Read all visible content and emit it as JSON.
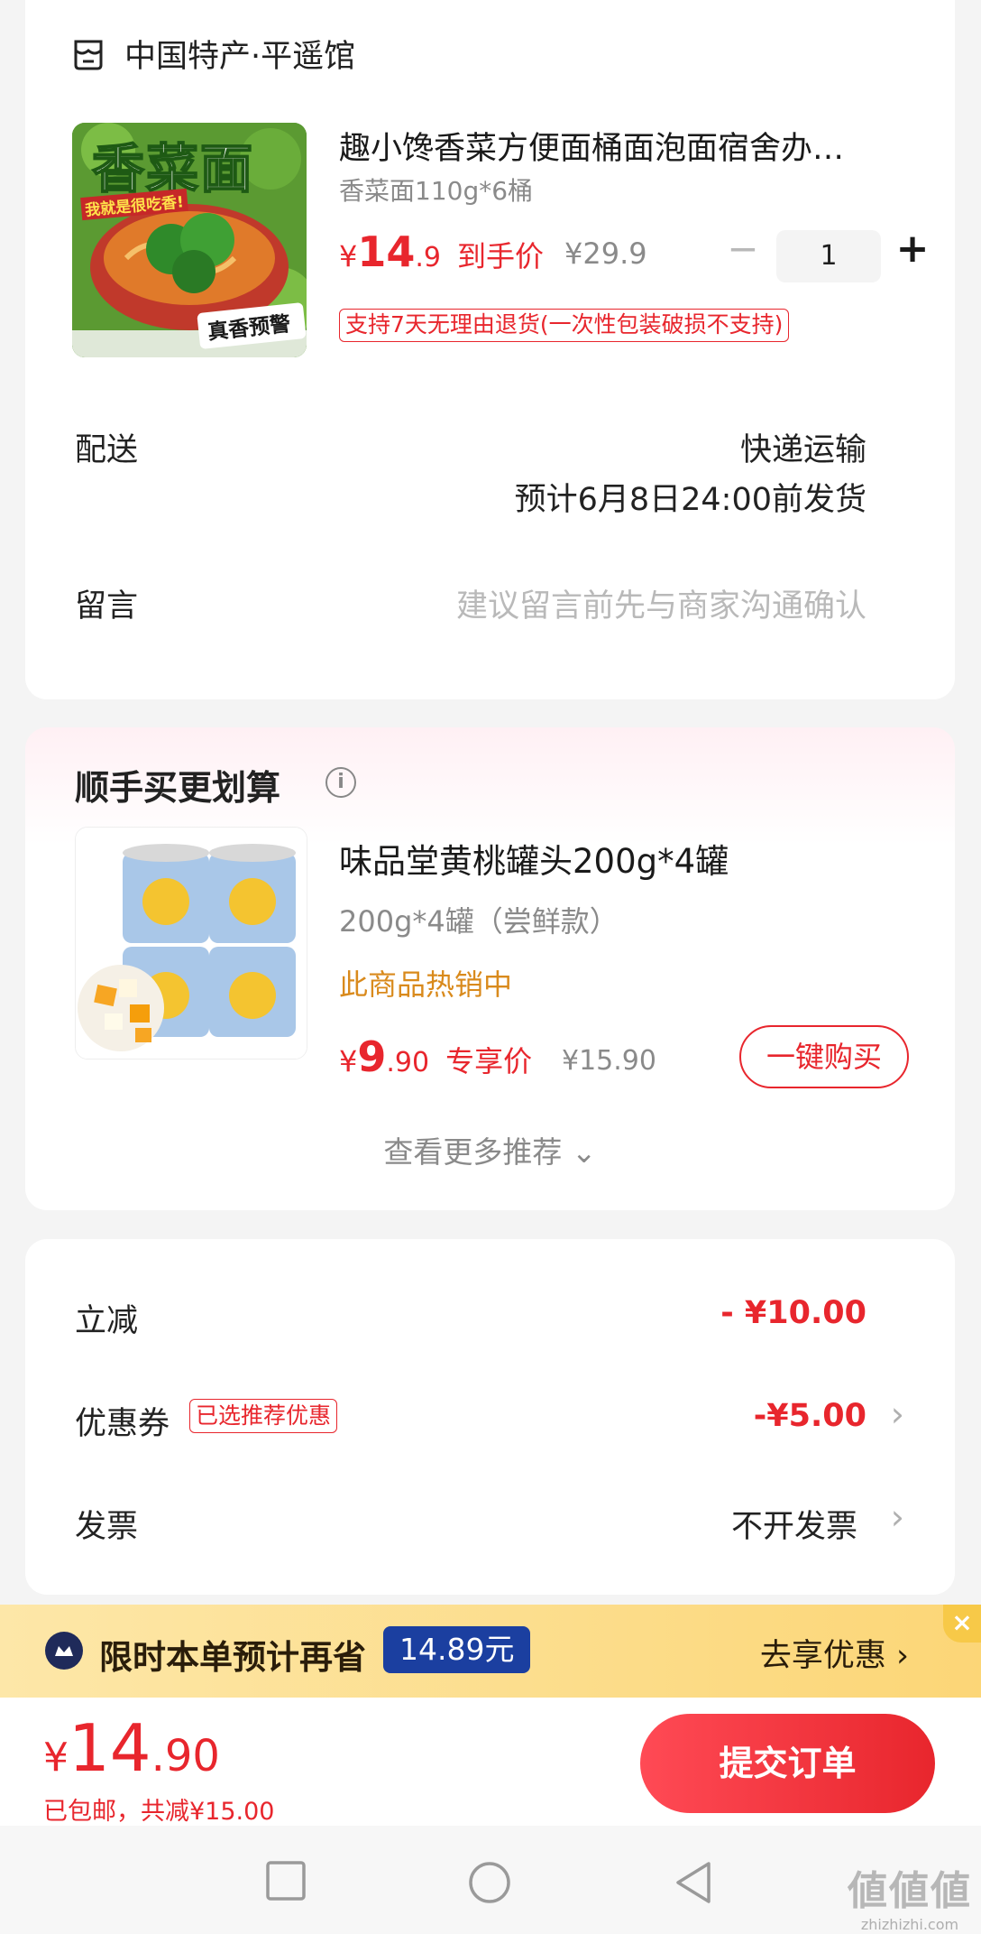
{
  "shop": {
    "name": "中国特产·平遥馆"
  },
  "product": {
    "image_label": "香菜面",
    "image_slogan": "我就是很吃香!",
    "image_badge": "真香预警",
    "title": "趣小馋香菜方便面桶面泡面宿舍办…",
    "spec": "香菜面110g*6桶",
    "price_symbol": "¥",
    "price_int": "14",
    "price_dec": ".9",
    "price_tag": "到手价",
    "original_price": "¥29.9",
    "minus": "−",
    "quantity": "1",
    "plus": "+",
    "policy": "支持7天无理由退货(一次性包装破损不支持)"
  },
  "delivery": {
    "label": "配送",
    "method": "快递运输",
    "estimate": "预计6月8日24:00前发货"
  },
  "message": {
    "label": "留言",
    "placeholder": "建议留言前先与商家沟通确认"
  },
  "recommend": {
    "title": "顺手买更划算",
    "info_icon": "i",
    "item": {
      "image_label": "椰果黄桃罐头",
      "title": "味品堂黄桃罐头200g*4罐",
      "spec": "200g*4罐（尝鲜款）",
      "hot": "此商品热销中",
      "price_symbol": "¥",
      "price_int": "9",
      "price_dec": ".90",
      "price_tag": "专享价",
      "original_price": "¥15.90",
      "buy_label": "一键购买"
    },
    "more_label": "查看更多推荐 ⌄"
  },
  "discounts": {
    "instant": {
      "label": "立减",
      "value": "- ¥10.00"
    },
    "coupon": {
      "label": "优惠券",
      "tag": "已选推荐优惠",
      "value": "-¥5.00"
    },
    "invoice": {
      "label": "发票",
      "value": "不开发票"
    },
    "chevron": "›"
  },
  "promo": {
    "text": "限时本单预计再省",
    "amount": "14.89元",
    "action": "去享优惠 ›",
    "close": "×"
  },
  "checkout": {
    "price_symbol": "¥",
    "price_int": "14",
    "price_dec": ".90",
    "shipping_note": "已包邮，共减¥15.00",
    "submit_label": "提交订单"
  },
  "watermark": {
    "big": "値値値",
    "small": "zhizhizhi.com"
  },
  "colors": {
    "accent": "#e8262d",
    "hot": "#d98a1c",
    "promo_bg": "#fcd677",
    "promo_amount_bg": "#1b3fa0"
  }
}
